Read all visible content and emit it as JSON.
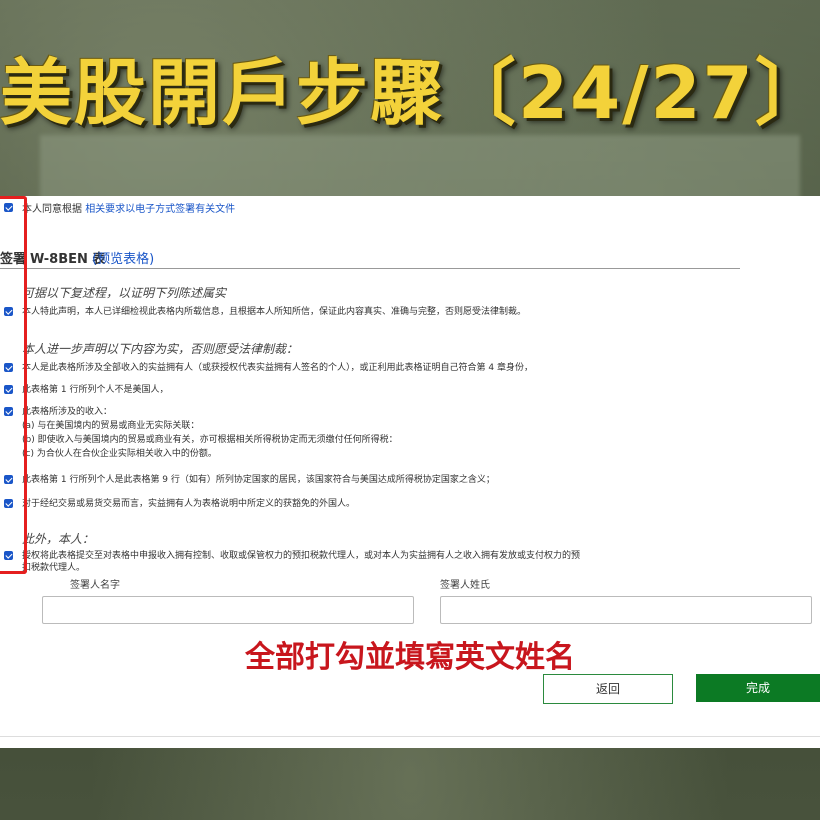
{
  "banner": {
    "title": "美股開戶步驟〔24/27〕"
  },
  "form": {
    "consent": {
      "prefix": "本人同意根据",
      "link": "相关要求以电子方式签署有关文件"
    },
    "section_title": {
      "prefix": "签署",
      "name": "W-8BEN 表",
      "link": "(预览表格)"
    },
    "perjury_heading": "可据以下复述程，以证明下列陈述属实",
    "perjury_text": "本人特此声明，本人已详细检视此表格内所载信息，且根据本人所知所信，保证此内容真实、准确与完整，否则愿受法律制裁。",
    "further_heading": "本人进一步声明以下内容为实，否则愿受法律制裁：",
    "items": [
      "本人是此表格所涉及全部收入的实益拥有人（或获授权代表实益拥有人签名的个人），或正利用此表格证明自己符合第 4 章身份，",
      "此表格第 1 行所列个人不是美国人，",
      "此表格所涉及的收入：",
      "此表格第 1 行所列个人是此表格第 9 行（如有）所列协定国家的居民，该国家符合与美国达成所得税协定国家之含义；",
      "对于经纪交易或易货交易而言，实益拥有人为表格说明中所定义的获豁免的外国人。"
    ],
    "income_subitems": [
      "(a) 与在美国境内的贸易或商业无实际关联：",
      "(b) 即使收入与美国境内的贸易或商业有关，亦可根据相关所得税协定而无须缴付任何所得税：",
      "(c) 为合伙人在合伙企业实际相关收入中的份额。"
    ],
    "furthermore_heading": "此外，本人：",
    "furthermore_text": "授权将此表格提交至对表格中申报收入拥有控制、收取或保管权力的预扣税款代理人，或对本人为实益拥有人之收入拥有发放或支付权力的预",
    "furthermore_text2": "扣税款代理人。",
    "first_name_label": "签署人名字",
    "last_name_label": "签署人姓氏",
    "first_name_value": "",
    "last_name_value": "",
    "back_button": "返回",
    "done_button": "完成"
  },
  "annotation": {
    "note": "全部打勾並填寫英文姓名"
  },
  "colors": {
    "title": "#f3d23a",
    "checkbox": "#1a56c8",
    "highlight": "#e51f1f",
    "note": "#c8161d",
    "done_button": "#0c7a24"
  }
}
